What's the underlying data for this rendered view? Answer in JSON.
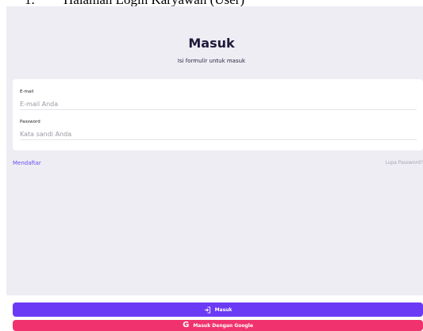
{
  "caption": {
    "number": "1.",
    "text": "Halaman Login Karyawan (User)"
  },
  "header": {
    "title": "Masuk",
    "subtitle": "Isi formulir untuk masuk"
  },
  "form": {
    "email": {
      "label": "E-mail",
      "value": "",
      "placeholder": "E-mail Anda"
    },
    "password": {
      "label": "Password",
      "value": "",
      "placeholder": "Kata sandi Anda"
    }
  },
  "links": {
    "register": "Mendaftar",
    "forgot": "Lupa Password?"
  },
  "buttons": {
    "login": "Masuk",
    "google": "Masuk Dengan Google",
    "google_icon_glyph": "G"
  },
  "icons": {
    "login": "login-arrow-icon",
    "google": "google-icon"
  },
  "colors": {
    "background": "#eeedf3",
    "primary": "#6b3af5",
    "google": "#f0336f",
    "link": "#6a4cf0"
  }
}
